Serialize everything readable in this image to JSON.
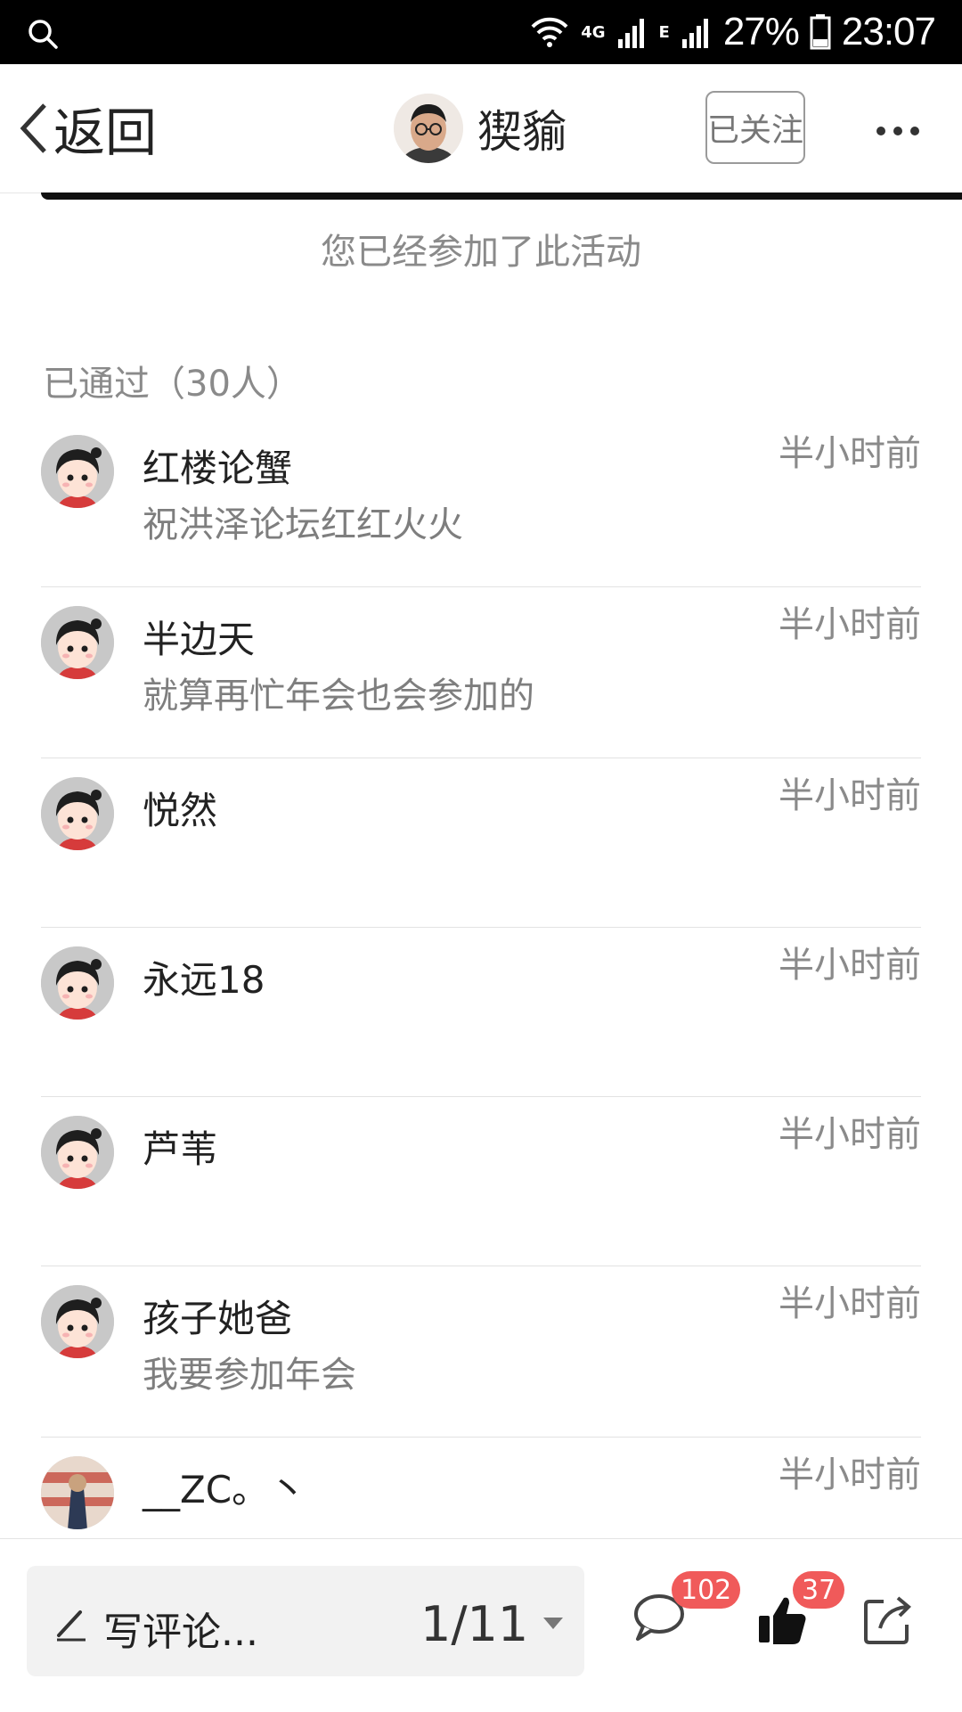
{
  "status_bar": {
    "network": "4G",
    "network_e": "E",
    "battery": "27%",
    "time": "23:07"
  },
  "header": {
    "back_label": "返回",
    "author_name": "猰貐",
    "follow_label": "已关注"
  },
  "banner": {
    "joined_text": "您已经参加了此活动"
  },
  "approved_title": "已通过（30人）",
  "members": [
    {
      "name": "红楼论蟹",
      "message": "祝洪泽论坛红红火火",
      "time": "半小时前"
    },
    {
      "name": "半边天",
      "message": "就算再忙年会也会参加的",
      "time": "半小时前"
    },
    {
      "name": "悦然",
      "message": "",
      "time": "半小时前"
    },
    {
      "name": "永远18",
      "message": "",
      "time": "半小时前"
    },
    {
      "name": "芦苇",
      "message": "",
      "time": "半小时前"
    },
    {
      "name": "孩子她爸",
      "message": "我要参加年会",
      "time": "半小时前"
    },
    {
      "name": "__ZC。丶",
      "message": "",
      "time": "半小时前"
    }
  ],
  "bottom_bar": {
    "comment_placeholder": "写评论...",
    "page_indicator": "1/11",
    "comment_count": "102",
    "like_count": "37"
  },
  "colors": {
    "badge": "#f05a5a",
    "status_bar_bg": "#000000"
  }
}
